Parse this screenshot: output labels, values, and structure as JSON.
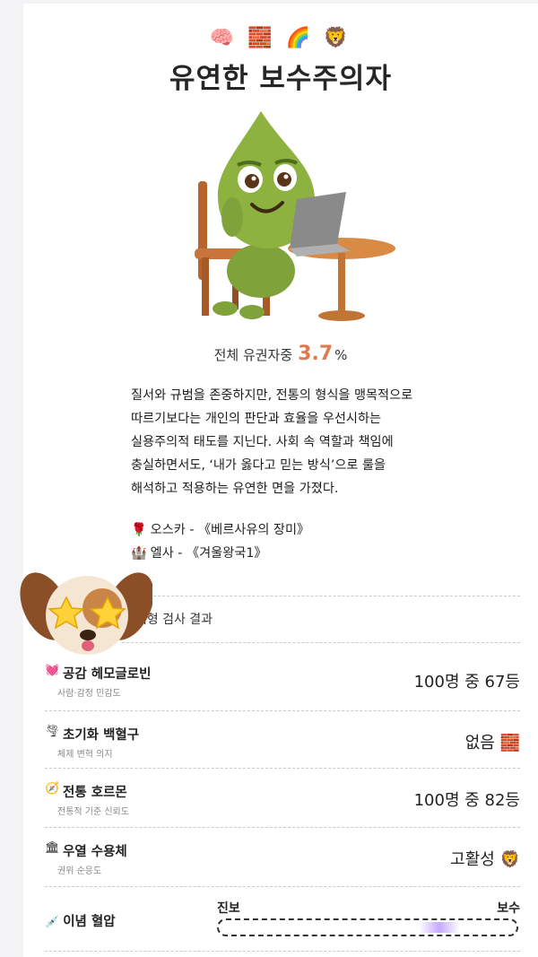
{
  "header": {
    "emojis": "🧠 🧱 🌈 🦁",
    "title": "유연한 보수주의자"
  },
  "stats": {
    "prefix": "전체 유권자중",
    "value": "3.7",
    "unit": "%"
  },
  "description": "질서와 규범을 존중하지만, 전통의 형식을 맹목적으로\n따르기보다는 개인의 판단과 효율을 우선시하는\n실용주의적 태도를 지닌다. 사회 속 역할과 책임에\n충실하면서도, ‘내가 옳다고 믿는 방식’으로 룰을\n해석하고 적용하는 유연한 면을 가졌다.",
  "characters": [
    {
      "emoji": "🌹",
      "text": "오스카 - 《베르사유의 장미》"
    },
    {
      "emoji": "🏰",
      "text": "엘사 - 《겨울왕국1》"
    }
  ],
  "results": {
    "section_title": "혈액형 검사 결과",
    "items": [
      {
        "icon": "💓",
        "name": "공감 헤모글로빈",
        "sub": "사람·감정 민감도",
        "value": "100명 중 67등"
      },
      {
        "icon": "🌪",
        "name": "초기화 백혈구",
        "sub": "체제 변혁 의지",
        "value": "없음 🧱"
      },
      {
        "icon": "🧭",
        "name": "전통 호르몬",
        "sub": "전통적 기준 신뢰도",
        "value": "100명 중 82등"
      },
      {
        "icon": "🏛",
        "name": "우열 수용체",
        "sub": "권위 순응도",
        "value": "고활성 🦁"
      }
    ],
    "ideology": {
      "icon": "💉",
      "label": "이념 혈압",
      "left": "진보",
      "right": "보수",
      "position": 0.78
    }
  }
}
